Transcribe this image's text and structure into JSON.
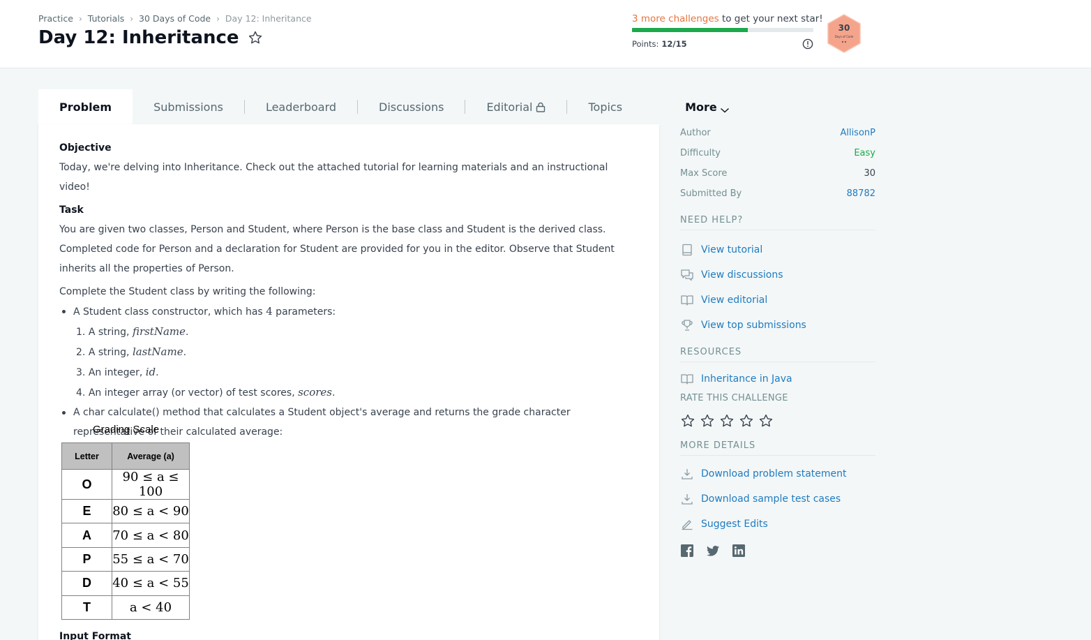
{
  "breadcrumb": [
    "Practice",
    "Tutorials",
    "30 Days of Code",
    "Day 12: Inheritance"
  ],
  "title": "Day 12: Inheritance",
  "progress": {
    "highlight": "3 more challenges",
    "message_rest": " to get your next star!",
    "points_label": "Points:",
    "points_value": "12/15",
    "fill_fraction": 0.64
  },
  "badge": {
    "number": "30",
    "subtitle": "Days of Code",
    "color": "#f5a48c"
  },
  "tabs": {
    "problem": "Problem",
    "submissions": "Submissions",
    "leaderboard": "Leaderboard",
    "discussions": "Discussions",
    "editorial": "Editorial",
    "topics": "Topics",
    "more": "More"
  },
  "problem": {
    "objective_heading": "Objective",
    "objective_text": "Today, we're delving into Inheritance. Check out the attached tutorial for learning materials and an instructional video!",
    "task_heading": "Task",
    "task_text": "You are given two classes, Person and Student, where Person is the base class and Student is the derived class. Completed code for Person and a declaration for Student are provided for you in the editor. Observe that Student inherits all the properties of Person.",
    "complete_text": "Complete the Student class by writing the following:",
    "bullet1_pre": "A Student class constructor, which has ",
    "bullet1_num": "4",
    "bullet1_post": " parameters:",
    "params": [
      {
        "n": "1.",
        "pre": "A string, ",
        "math": "firstName",
        "post": "."
      },
      {
        "n": "2.",
        "pre": "A string, ",
        "math": "lastName",
        "post": "."
      },
      {
        "n": "3.",
        "pre": "An integer, ",
        "math": "id",
        "post": "."
      },
      {
        "n": "4.",
        "pre": "An integer array (or vector) of test scores, ",
        "math": "scores",
        "post": "."
      }
    ],
    "bullet2": "A char calculate() method that calculates a Student object's average and returns the grade character representative of their calculated average:",
    "grading_title": "Grading Scale",
    "grading_headers": [
      "Letter",
      "Average (a)"
    ],
    "grading_rows": [
      [
        "O",
        "90 ≤ a ≤ 100"
      ],
      [
        "E",
        "80 ≤ a < 90"
      ],
      [
        "A",
        "70 ≤ a < 80"
      ],
      [
        "P",
        "55 ≤ a < 70"
      ],
      [
        "D",
        "40 ≤ a < 55"
      ],
      [
        "T",
        "a < 40"
      ]
    ],
    "input_format_heading": "Input Format"
  },
  "sidebar": {
    "meta": [
      {
        "key": "Author",
        "value": "AllisonP",
        "style": "link"
      },
      {
        "key": "Difficulty",
        "value": "Easy",
        "style": "easy"
      },
      {
        "key": "Max Score",
        "value": "30",
        "style": "plain"
      },
      {
        "key": "Submitted By",
        "value": "88782",
        "style": "link"
      }
    ],
    "need_help": "NEED HELP?",
    "help_links": [
      "View tutorial",
      "View discussions",
      "View editorial",
      "View top submissions"
    ],
    "resources": "RESOURCES",
    "resource_links": [
      "Inheritance in Java"
    ],
    "rate": "RATE THIS CHALLENGE",
    "rating_stars": 0,
    "more_details": "MORE DETAILS",
    "detail_links": [
      "Download problem statement",
      "Download sample test cases",
      "Suggest Edits"
    ]
  },
  "colors": {
    "accent_link": "#1f7bc1",
    "progress_green": "#1ba94c",
    "highlight_orange": "#e7733c"
  }
}
